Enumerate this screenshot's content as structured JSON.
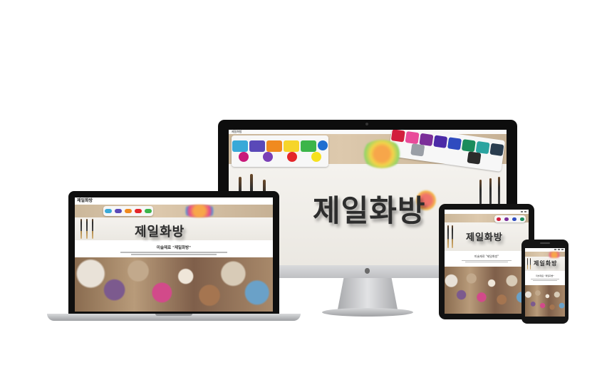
{
  "logo_text": "제일화방",
  "caption_title": "미술재료 \"제일화방\"",
  "tablet_caption": "미술재료 \"제일화방\"",
  "phone_caption": "미술재료 \"제일화방\"",
  "desktop_nav_logo": "제일화방",
  "laptop_nav_logo": "제일화방",
  "colors": {
    "background": "#ffffff",
    "device_frame": "#111111",
    "aluminum": "#c8c9cc"
  },
  "icons": [
    "apple-logo-icon",
    "camera-icon"
  ]
}
